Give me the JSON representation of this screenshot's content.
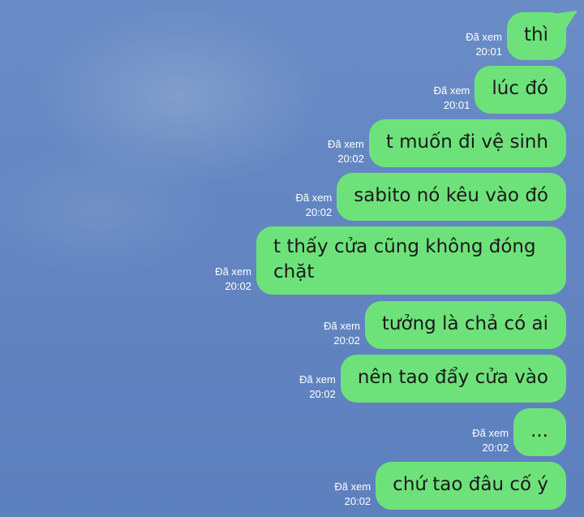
{
  "messages": [
    {
      "text": "thì",
      "status": "Đã xem",
      "time": "20:01"
    },
    {
      "text": "lúc đó",
      "status": "Đã xem",
      "time": "20:01"
    },
    {
      "text": "t muốn đi vệ sinh",
      "status": "Đã xem",
      "time": "20:02"
    },
    {
      "text": "sabito nó kêu vào đó",
      "status": "Đã xem",
      "time": "20:02"
    },
    {
      "text": "t thấy cửa cũng không đóng chặt",
      "status": "Đã xem",
      "time": "20:02"
    },
    {
      "text": "tưởng là chả có ai",
      "status": "Đã xem",
      "time": "20:02"
    },
    {
      "text": "nên tao đẩy cửa vào",
      "status": "Đã xem",
      "time": "20:02"
    },
    {
      "text": "...",
      "status": "Đã xem",
      "time": "20:02"
    },
    {
      "text": "chứ tao đâu cố ý",
      "status": "Đã xem",
      "time": "20:02"
    }
  ]
}
